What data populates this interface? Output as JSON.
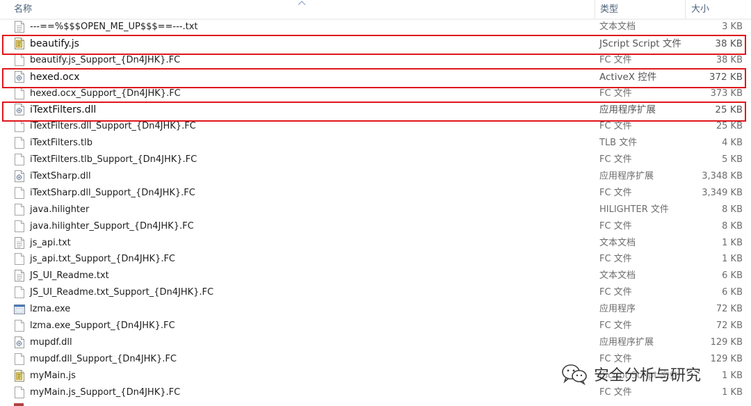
{
  "columns": {
    "name": "名称",
    "type": "类型",
    "size": "大小"
  },
  "files": [
    {
      "name": "---==%$$$OPEN_ME_UP$$$==---.txt",
      "type": "文本文档",
      "size": "3 KB",
      "icon": "text-file-icon",
      "highlighted": false
    },
    {
      "name": "beautify.js",
      "type": "JScript Script 文件",
      "size": "38 KB",
      "icon": "script-file-icon",
      "highlighted": true
    },
    {
      "name": "beautify.js_Support_{Dn4JHK}.FC",
      "type": "FC 文件",
      "size": "38 KB",
      "icon": "blank-file-icon",
      "highlighted": false
    },
    {
      "name": "hexed.ocx",
      "type": "ActiveX 控件",
      "size": "372 KB",
      "icon": "dll-file-icon",
      "highlighted": true
    },
    {
      "name": "hexed.ocx_Support_{Dn4JHK}.FC",
      "type": "FC 文件",
      "size": "373 KB",
      "icon": "blank-file-icon",
      "highlighted": false
    },
    {
      "name": "iTextFilters.dll",
      "type": "应用程序扩展",
      "size": "25 KB",
      "icon": "dll-file-icon",
      "highlighted": true
    },
    {
      "name": "iTextFilters.dll_Support_{Dn4JHK}.FC",
      "type": "FC 文件",
      "size": "25 KB",
      "icon": "blank-file-icon",
      "highlighted": false
    },
    {
      "name": "iTextFilters.tlb",
      "type": "TLB 文件",
      "size": "4 KB",
      "icon": "blank-file-icon",
      "highlighted": false
    },
    {
      "name": "iTextFilters.tlb_Support_{Dn4JHK}.FC",
      "type": "FC 文件",
      "size": "5 KB",
      "icon": "blank-file-icon",
      "highlighted": false
    },
    {
      "name": "iTextSharp.dll",
      "type": "应用程序扩展",
      "size": "3,348 KB",
      "icon": "dll-file-icon",
      "highlighted": false
    },
    {
      "name": "iTextSharp.dll_Support_{Dn4JHK}.FC",
      "type": "FC 文件",
      "size": "3,349 KB",
      "icon": "blank-file-icon",
      "highlighted": false
    },
    {
      "name": "java.hilighter",
      "type": "HILIGHTER 文件",
      "size": "8 KB",
      "icon": "blank-file-icon",
      "highlighted": false
    },
    {
      "name": "java.hilighter_Support_{Dn4JHK}.FC",
      "type": "FC 文件",
      "size": "8 KB",
      "icon": "blank-file-icon",
      "highlighted": false
    },
    {
      "name": "js_api.txt",
      "type": "文本文档",
      "size": "1 KB",
      "icon": "text-file-icon",
      "highlighted": false
    },
    {
      "name": "js_api.txt_Support_{Dn4JHK}.FC",
      "type": "FC 文件",
      "size": "1 KB",
      "icon": "blank-file-icon",
      "highlighted": false
    },
    {
      "name": "JS_UI_Readme.txt",
      "type": "文本文档",
      "size": "6 KB",
      "icon": "text-file-icon",
      "highlighted": false
    },
    {
      "name": "JS_UI_Readme.txt_Support_{Dn4JHK}.FC",
      "type": "FC 文件",
      "size": "6 KB",
      "icon": "blank-file-icon",
      "highlighted": false
    },
    {
      "name": "lzma.exe",
      "type": "应用程序",
      "size": "72 KB",
      "icon": "exe-file-icon",
      "highlighted": false
    },
    {
      "name": "lzma.exe_Support_{Dn4JHK}.FC",
      "type": "FC 文件",
      "size": "72 KB",
      "icon": "blank-file-icon",
      "highlighted": false
    },
    {
      "name": "mupdf.dll",
      "type": "应用程序扩展",
      "size": "129 KB",
      "icon": "dll-file-icon",
      "highlighted": false
    },
    {
      "name": "mupdf.dll_Support_{Dn4JHK}.FC",
      "type": "FC 文件",
      "size": "129 KB",
      "icon": "blank-file-icon",
      "highlighted": false
    },
    {
      "name": "myMain.js",
      "type": "JScript Script 文件",
      "size": "1 KB",
      "icon": "script-file-icon",
      "highlighted": false
    },
    {
      "name": "myMain.js_Support_{Dn4JHK}.FC",
      "type": "FC 文件",
      "size": "1 KB",
      "icon": "blank-file-icon",
      "highlighted": false
    }
  ],
  "watermark": {
    "text": "安全分析与研究",
    "icon": "wechat-logo-icon"
  },
  "colors": {
    "highlight_border": "#e0161b",
    "header_text": "#4c607a",
    "secondary_text": "#6d6d6d"
  }
}
